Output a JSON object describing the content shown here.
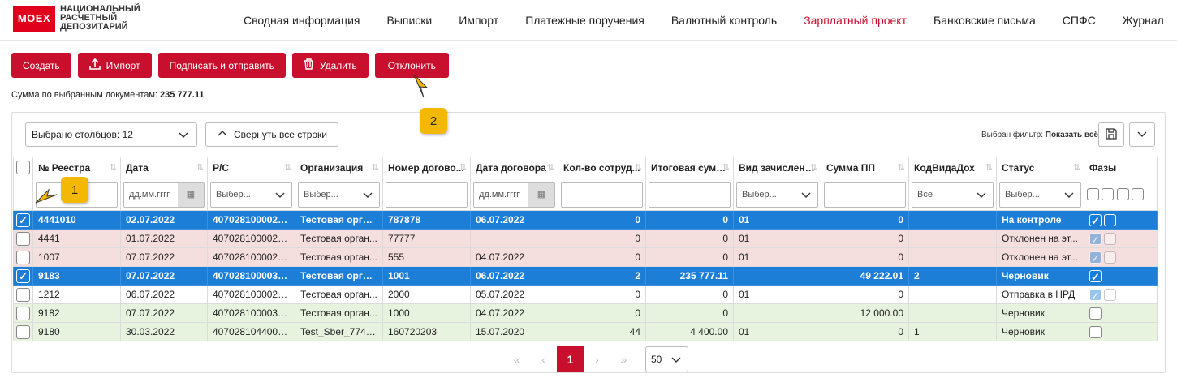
{
  "logo": {
    "mark": "MOEX",
    "line1": "НАЦИОНАЛЬНЫЙ",
    "line2": "РАСЧЕТНЫЙ",
    "line3": "ДЕПОЗИТАРИЙ"
  },
  "nav": [
    {
      "label": "Сводная информация"
    },
    {
      "label": "Выписки"
    },
    {
      "label": "Импорт"
    },
    {
      "label": "Платежные поручения"
    },
    {
      "label": "Валютный контроль"
    },
    {
      "label": "Зарплатный проект"
    },
    {
      "label": "Банковские письма"
    },
    {
      "label": "СПФС"
    },
    {
      "label": "Журнал"
    }
  ],
  "toolbar": {
    "create": "Создать",
    "import": "Импорт",
    "sign_send": "Подписать и отправить",
    "delete": "Удалить",
    "reject": "Отклонить"
  },
  "summary": {
    "label": "Сумма по выбранным документам:",
    "value": "235 777.11"
  },
  "panel": {
    "columns_select": "Выбрано столбцов: 12",
    "collapse": "Свернуть все строки",
    "filter_label": "Выбран фильтр:",
    "filter_value": "Показать всё"
  },
  "columns": [
    "№ Реестра",
    "Дата",
    "Р/С",
    "Организация",
    "Номер догово...",
    "Дата договора",
    "Кол-во сотруд...",
    "Итоговая сумма",
    "Вид зачисления",
    "Сумма ПП",
    "КодВидаДох",
    "Статус",
    "Фазы"
  ],
  "filters": {
    "date_placeholder": "дд.мм.гггг",
    "select_placeholder": "Выбер...",
    "all": "Все"
  },
  "rows": [
    {
      "id": "4441010",
      "date": "02.07.2022",
      "account": "4070281000022...",
      "org": "Тестовая орган...",
      "contract": "787878",
      "cdate": "06.07.2022",
      "emp": "0",
      "total": "0",
      "kind": "01",
      "pp": "0",
      "code": "",
      "status": "На контроле"
    },
    {
      "id": "4441",
      "date": "01.07.2022",
      "account": "4070281000022...",
      "org": "Тестовая орган...",
      "contract": "77777",
      "cdate": "",
      "emp": "0",
      "total": "0",
      "kind": "01",
      "pp": "0",
      "code": "",
      "status": "Отклонен на эт..."
    },
    {
      "id": "1007",
      "date": "07.07.2022",
      "account": "4070281000022...",
      "org": "Тестовая орган...",
      "contract": "555",
      "cdate": "04.07.2022",
      "emp": "0",
      "total": "0",
      "kind": "01",
      "pp": "0",
      "code": "",
      "status": "Отклонен на эт..."
    },
    {
      "id": "9183",
      "date": "07.07.2022",
      "account": "4070281000039...",
      "org": "Тестовая орган...",
      "contract": "1001",
      "cdate": "06.07.2022",
      "emp": "2",
      "total": "235 777.11",
      "kind": "",
      "pp": "49 222.01",
      "code": "2",
      "status": "Черновик"
    },
    {
      "id": "1212",
      "date": "06.07.2022",
      "account": "4070281000022...",
      "org": "Тестовая орган...",
      "contract": "2000",
      "cdate": "05.07.2022",
      "emp": "0",
      "total": "0",
      "kind": "01",
      "pp": "0",
      "code": "",
      "status": "Отправка в НРД"
    },
    {
      "id": "9182",
      "date": "07.07.2022",
      "account": "4070281000039...",
      "org": "Тестовая орган...",
      "contract": "1000",
      "cdate": "04.07.2022",
      "emp": "0",
      "total": "0",
      "kind": "",
      "pp": "12 000.00",
      "code": "",
      "status": "Черновик"
    },
    {
      "id": "9180",
      "date": "30.03.2022",
      "account": "4070281044000...",
      "org": "Test_Sber_7746...",
      "contract": "160720203",
      "cdate": "15.07.2020",
      "emp": "44",
      "total": "4 400.00",
      "kind": "01",
      "pp": "0",
      "code": "1",
      "status": "Черновик"
    }
  ],
  "pagination": {
    "current": "1",
    "page_size": "50"
  },
  "callouts": {
    "first": "1",
    "second": "2"
  },
  "colors": {
    "accent": "#c8102e",
    "selected": "#1c7ed6",
    "pink": "#f4dede",
    "green": "#e7f2df",
    "callout": "#f5b800"
  }
}
